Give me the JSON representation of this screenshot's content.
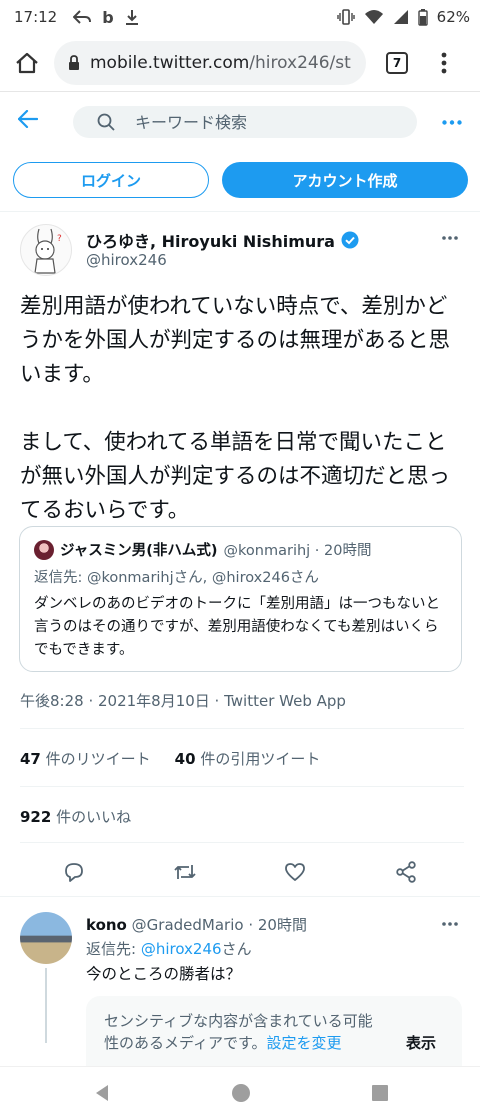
{
  "status_bar": {
    "time": "17:12",
    "battery": "62%",
    "left_icons": [
      "back-arrow-icon",
      "b-icon",
      "download-icon"
    ],
    "right_icons": [
      "vibrate-icon",
      "wifi-icon",
      "signal-icon",
      "battery-icon"
    ]
  },
  "browser": {
    "url_main": "mobile.twitter.com",
    "url_path": "/hirox246/st",
    "tab_count": "7"
  },
  "header": {
    "search_placeholder": "キーワード検索"
  },
  "auth": {
    "login_label": "ログイン",
    "signup_label": "アカウント作成"
  },
  "tweet": {
    "author_name": "ひろゆき, Hiroyuki Nishimura",
    "handle": "@hirox246",
    "verified": true,
    "text": "差別用語が使われていない時点で、差別かどうかを外国人が判定するのは無理があると思います。\n\nまして、使われてる単語を日常で聞いたことが無い外国人が判定するのは不適切だと思ってるおいらです。",
    "quote": {
      "name": "ジャスミン男(非ハム式)",
      "meta": "@konmarihj · 20時間",
      "reply_to": "返信先: @konmarihjさん, @hirox246さん",
      "text": "ダンベレのあのビデオのトークに「差別用語」は一つもないと言うのはその通りですが、差別用語使わなくても差別はいくらでもできます。"
    },
    "timestamp": "午後8:28 · 2021年8月10日 · Twitter Web App",
    "retweets_count": "47",
    "retweets_label": "件のリツイート",
    "quotes_count": "40",
    "quotes_label": "件の引用ツイート",
    "likes_count": "922",
    "likes_label": "件のいいね"
  },
  "actions": [
    "reply-icon",
    "retweet-icon",
    "like-icon",
    "share-icon"
  ],
  "reply": {
    "name": "kono",
    "meta": "@GradedMario · 20時間",
    "reply_prefix": "返信先: ",
    "reply_link": "@hirox246",
    "reply_suffix": "さん",
    "text": "今のところの勝者は？",
    "sensitive_text": "センシティブな内容が含まれている可能性のあるメディアです。",
    "sensitive_link": "設定を変更",
    "sensitive_show": "表示"
  },
  "colors": {
    "accent": "#1d9bf0",
    "text": "#0f1419",
    "secondary_text": "#536471",
    "border": "#cfd9de"
  }
}
